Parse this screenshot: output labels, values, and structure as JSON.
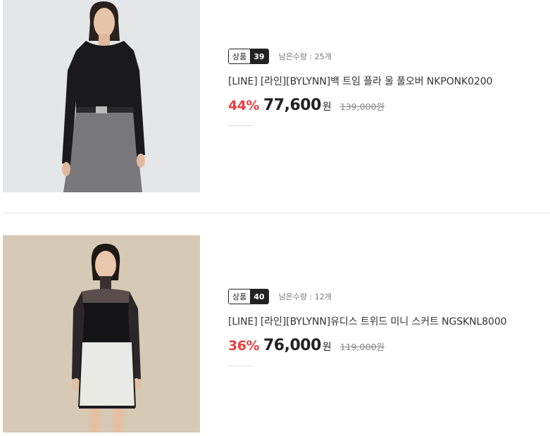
{
  "products": [
    {
      "badge_label": "상품",
      "badge_number": "39",
      "stock": "남은수량 : 25개",
      "title": "[LINE] [라인][BYLYNN]백 트임 플라 울 풀오버 NKPONK0200",
      "discount": "44%",
      "price": "77,600",
      "currency": "원",
      "original_price": "139,000원",
      "accent_color": "#e84040"
    },
    {
      "badge_label": "상품",
      "badge_number": "40",
      "stock": "남은수량 : 12개",
      "title": "[LINE] [라인][BYLYNN]유디스 트위드 미니 스커트 NGSKNL8000",
      "discount": "36%",
      "price": "76,000",
      "currency": "원",
      "original_price": "119,000원",
      "accent_color": "#e84040"
    }
  ]
}
